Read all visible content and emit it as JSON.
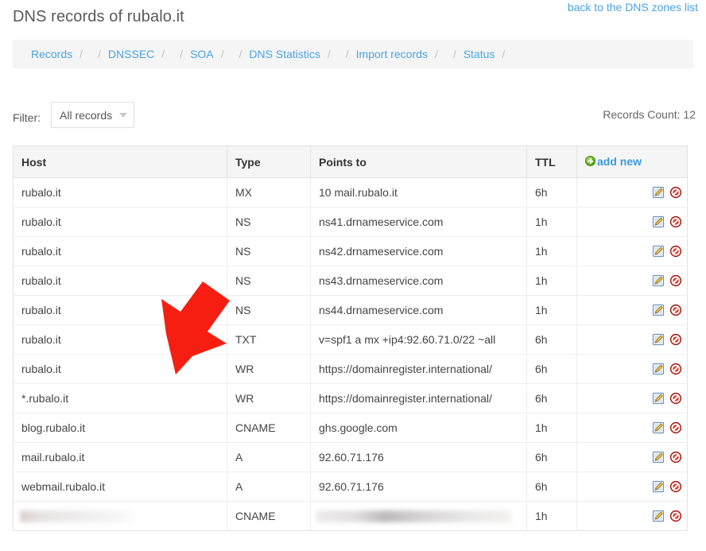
{
  "header": {
    "title": "DNS records of rubalo.it",
    "back_link": "back to the DNS zones list"
  },
  "subnav": {
    "separator": "/",
    "items": [
      {
        "label": "Records"
      },
      {
        "label": "DNSSEC"
      },
      {
        "label": "SOA"
      },
      {
        "label": "DNS Statistics"
      },
      {
        "label": "Import records"
      },
      {
        "label": "Status"
      }
    ]
  },
  "filter": {
    "label": "Filter:",
    "selected": "All records",
    "options": [
      "All records"
    ],
    "records_count": "Records Count: 12"
  },
  "table": {
    "columns": [
      "Host",
      "Type",
      "Points to",
      "TTL"
    ],
    "add_new_label": "add new",
    "rows": [
      {
        "host": "rubalo.it",
        "type": "MX",
        "points_to": "10 mail.rubalo.it",
        "ttl": "6h",
        "redacted": false
      },
      {
        "host": "rubalo.it",
        "type": "NS",
        "points_to": "ns41.drnameservice.com",
        "ttl": "1h",
        "redacted": false
      },
      {
        "host": "rubalo.it",
        "type": "NS",
        "points_to": "ns42.drnameservice.com",
        "ttl": "1h",
        "redacted": false
      },
      {
        "host": "rubalo.it",
        "type": "NS",
        "points_to": "ns43.drnameservice.com",
        "ttl": "1h",
        "redacted": false
      },
      {
        "host": "rubalo.it",
        "type": "NS",
        "points_to": "ns44.drnameservice.com",
        "ttl": "1h",
        "redacted": false
      },
      {
        "host": "rubalo.it",
        "type": "TXT",
        "points_to": "v=spf1 a mx +ip4:92.60.71.0/22 ~all",
        "ttl": "6h",
        "redacted": false
      },
      {
        "host": "rubalo.it",
        "type": "WR",
        "points_to": "https://domainregister.international/",
        "ttl": "6h",
        "redacted": false
      },
      {
        "host": "*.rubalo.it",
        "type": "WR",
        "points_to": "https://domainregister.international/",
        "ttl": "6h",
        "redacted": false
      },
      {
        "host": "blog.rubalo.it",
        "type": "CNAME",
        "points_to": "ghs.google.com",
        "ttl": "1h",
        "redacted": false
      },
      {
        "host": "mail.rubalo.it",
        "type": "A",
        "points_to": "92.60.71.176",
        "ttl": "6h",
        "redacted": false
      },
      {
        "host": "webmail.rubalo.it",
        "type": "A",
        "points_to": "92.60.71.176",
        "ttl": "6h",
        "redacted": false
      },
      {
        "host": "",
        "type": "CNAME",
        "points_to": "",
        "ttl": "1h",
        "redacted": true
      }
    ],
    "row_actions": {
      "edit": "edit-record",
      "delete": "delete-record"
    }
  },
  "annotation": {
    "arrow_color": "#f61e11",
    "points_at_row_index": 6
  },
  "colors": {
    "link": "#4aa3df",
    "accent_green": "#63b820",
    "accent_red": "#d42a2a",
    "header_bg": "#f5f5f5"
  }
}
